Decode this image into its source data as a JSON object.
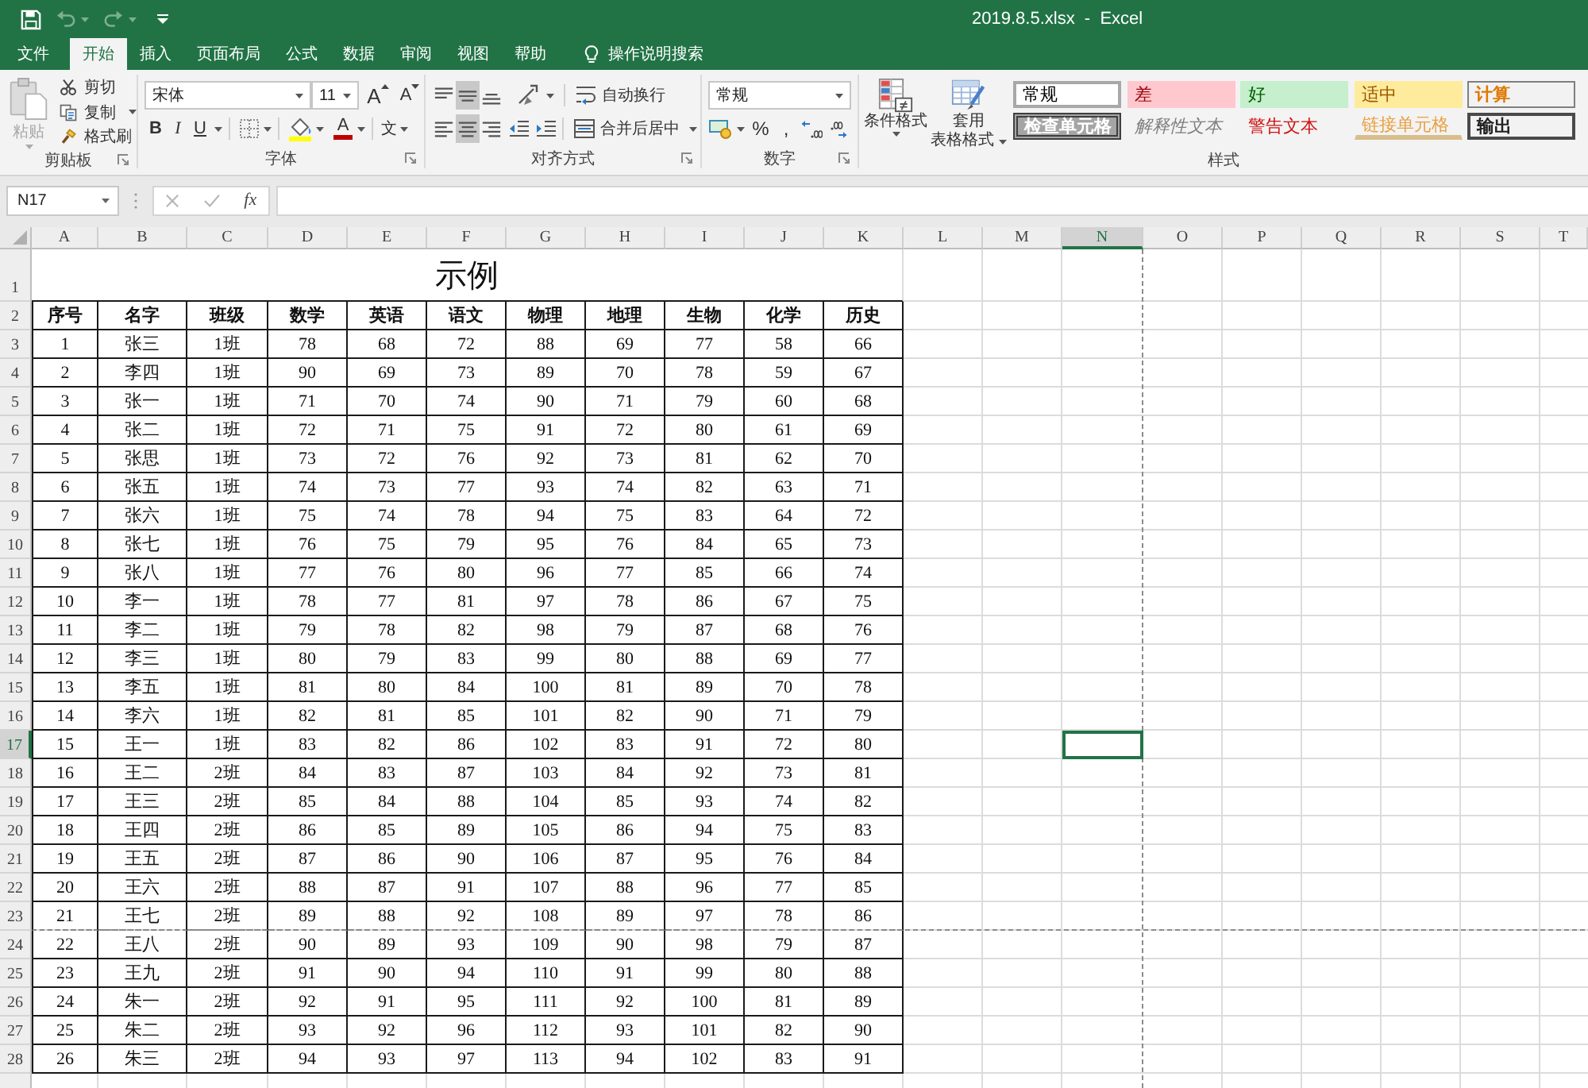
{
  "window": {
    "title": "2019.8.5.xlsx  -  Excel"
  },
  "quick_access": [
    {
      "kind": "save",
      "disabled": false
    },
    {
      "kind": "undo",
      "disabled": true
    },
    {
      "kind": "redo",
      "disabled": true
    },
    {
      "kind": "customize",
      "disabled": false
    }
  ],
  "tabs": [
    {
      "label": "文件",
      "selected": false
    },
    {
      "label": "开始",
      "selected": true
    },
    {
      "label": "插入",
      "selected": false
    },
    {
      "label": "页面布局",
      "selected": false
    },
    {
      "label": "公式",
      "selected": false
    },
    {
      "label": "数据",
      "selected": false
    },
    {
      "label": "审阅",
      "selected": false
    },
    {
      "label": "视图",
      "selected": false
    },
    {
      "label": "帮助",
      "selected": false
    }
  ],
  "tell_me": {
    "label": "操作说明搜索"
  },
  "ribbon": {
    "clipboard": {
      "label": "剪贴板",
      "paste": {
        "label": "粘贴",
        "disabled": true
      },
      "buttons": [
        {
          "kind": "cut",
          "label": "剪切"
        },
        {
          "kind": "copy",
          "label": "复制"
        },
        {
          "kind": "format_painter",
          "label": "格式刷"
        }
      ]
    },
    "font": {
      "label": "字体",
      "font_name": "宋体",
      "font_size": "11",
      "grow": "A",
      "shrink": "A",
      "styles": [
        {
          "kind": "bold",
          "label": "B"
        },
        {
          "kind": "italic",
          "label": "I"
        },
        {
          "kind": "underline",
          "label": "U"
        }
      ],
      "font_color": "A",
      "phonetic": "文"
    },
    "alignment": {
      "label": "对齐方式",
      "vertical": [
        {
          "kind": "top",
          "selected": false
        },
        {
          "kind": "middle",
          "selected": true
        },
        {
          "kind": "bottom",
          "selected": false
        }
      ],
      "horizontal": [
        {
          "kind": "left",
          "selected": false
        },
        {
          "kind": "center",
          "selected": true
        },
        {
          "kind": "right",
          "selected": false
        }
      ],
      "wrap_text": "自动换行",
      "merge_center": "合并后居中"
    },
    "number": {
      "label": "数字",
      "format": "常规",
      "percent": "%",
      "comma": ","
    },
    "styles": {
      "label": "样式",
      "conditional_format": "条件格式",
      "format_table": [
        "套用",
        "表格格式"
      ],
      "cell_styles": [
        {
          "kind": "normal",
          "label": "常规"
        },
        {
          "kind": "bad",
          "label": "差"
        },
        {
          "kind": "good",
          "label": "好"
        },
        {
          "kind": "neutral",
          "label": "适中"
        },
        {
          "kind": "calculation",
          "label": "计算"
        },
        {
          "kind": "check",
          "label": "检查单元格"
        },
        {
          "kind": "explanatory",
          "label": "解释性文本"
        },
        {
          "kind": "warning",
          "label": "警告文本"
        },
        {
          "kind": "linked",
          "label": "链接单元格"
        },
        {
          "kind": "output",
          "label": "输出"
        }
      ]
    }
  },
  "formula_bar": {
    "name_box": "N17",
    "function_label": "fx"
  },
  "sheet": {
    "columns": [
      {
        "label": "A",
        "selected": false
      },
      {
        "label": "B",
        "selected": false
      },
      {
        "label": "C",
        "selected": false
      },
      {
        "label": "D",
        "selected": false
      },
      {
        "label": "E",
        "selected": false
      },
      {
        "label": "F",
        "selected": false
      },
      {
        "label": "G",
        "selected": false
      },
      {
        "label": "H",
        "selected": false
      },
      {
        "label": "I",
        "selected": false
      },
      {
        "label": "J",
        "selected": false
      },
      {
        "label": "K",
        "selected": false
      },
      {
        "label": "L",
        "selected": false
      },
      {
        "label": "M",
        "selected": false
      },
      {
        "label": "N",
        "selected": true
      },
      {
        "label": "O",
        "selected": false
      },
      {
        "label": "P",
        "selected": false
      },
      {
        "label": "Q",
        "selected": false
      },
      {
        "label": "R",
        "selected": false
      },
      {
        "label": "S",
        "selected": false
      },
      {
        "label": "T",
        "selected": false
      }
    ],
    "rows": [
      {
        "label": "1",
        "selected": false
      },
      {
        "label": "2",
        "selected": false
      },
      {
        "label": "3",
        "selected": false
      },
      {
        "label": "4",
        "selected": false
      },
      {
        "label": "5",
        "selected": false
      },
      {
        "label": "6",
        "selected": false
      },
      {
        "label": "7",
        "selected": false
      },
      {
        "label": "8",
        "selected": false
      },
      {
        "label": "9",
        "selected": false
      },
      {
        "label": "10",
        "selected": false
      },
      {
        "label": "11",
        "selected": false
      },
      {
        "label": "12",
        "selected": false
      },
      {
        "label": "13",
        "selected": false
      },
      {
        "label": "14",
        "selected": false
      },
      {
        "label": "15",
        "selected": false
      },
      {
        "label": "16",
        "selected": false
      },
      {
        "label": "17",
        "selected": true
      },
      {
        "label": "18",
        "selected": false
      },
      {
        "label": "19",
        "selected": false
      },
      {
        "label": "20",
        "selected": false
      },
      {
        "label": "21",
        "selected": false
      },
      {
        "label": "22",
        "selected": false
      },
      {
        "label": "23",
        "selected": false
      },
      {
        "label": "24",
        "selected": false
      },
      {
        "label": "25",
        "selected": false
      },
      {
        "label": "26",
        "selected": false
      },
      {
        "label": "27",
        "selected": false
      },
      {
        "label": "28",
        "selected": false
      }
    ],
    "title": "示例",
    "table": {
      "header": [
        "序号",
        "名字",
        "班级",
        "数学",
        "英语",
        "语文",
        "物理",
        "地理",
        "生物",
        "化学",
        "历史"
      ],
      "rows": [
        [
          "1",
          "张三",
          "1班",
          "78",
          "68",
          "72",
          "88",
          "69",
          "77",
          "58",
          "66"
        ],
        [
          "2",
          "李四",
          "1班",
          "90",
          "69",
          "73",
          "89",
          "70",
          "78",
          "59",
          "67"
        ],
        [
          "3",
          "张一",
          "1班",
          "71",
          "70",
          "74",
          "90",
          "71",
          "79",
          "60",
          "68"
        ],
        [
          "4",
          "张二",
          "1班",
          "72",
          "71",
          "75",
          "91",
          "72",
          "80",
          "61",
          "69"
        ],
        [
          "5",
          "张思",
          "1班",
          "73",
          "72",
          "76",
          "92",
          "73",
          "81",
          "62",
          "70"
        ],
        [
          "6",
          "张五",
          "1班",
          "74",
          "73",
          "77",
          "93",
          "74",
          "82",
          "63",
          "71"
        ],
        [
          "7",
          "张六",
          "1班",
          "75",
          "74",
          "78",
          "94",
          "75",
          "83",
          "64",
          "72"
        ],
        [
          "8",
          "张七",
          "1班",
          "76",
          "75",
          "79",
          "95",
          "76",
          "84",
          "65",
          "73"
        ],
        [
          "9",
          "张八",
          "1班",
          "77",
          "76",
          "80",
          "96",
          "77",
          "85",
          "66",
          "74"
        ],
        [
          "10",
          "李一",
          "1班",
          "78",
          "77",
          "81",
          "97",
          "78",
          "86",
          "67",
          "75"
        ],
        [
          "11",
          "李二",
          "1班",
          "79",
          "78",
          "82",
          "98",
          "79",
          "87",
          "68",
          "76"
        ],
        [
          "12",
          "李三",
          "1班",
          "80",
          "79",
          "83",
          "99",
          "80",
          "88",
          "69",
          "77"
        ],
        [
          "13",
          "李五",
          "1班",
          "81",
          "80",
          "84",
          "100",
          "81",
          "89",
          "70",
          "78"
        ],
        [
          "14",
          "李六",
          "1班",
          "82",
          "81",
          "85",
          "101",
          "82",
          "90",
          "71",
          "79"
        ],
        [
          "15",
          "王一",
          "1班",
          "83",
          "82",
          "86",
          "102",
          "83",
          "91",
          "72",
          "80"
        ],
        [
          "16",
          "王二",
          "2班",
          "84",
          "83",
          "87",
          "103",
          "84",
          "92",
          "73",
          "81"
        ],
        [
          "17",
          "王三",
          "2班",
          "85",
          "84",
          "88",
          "104",
          "85",
          "93",
          "74",
          "82"
        ],
        [
          "18",
          "王四",
          "2班",
          "86",
          "85",
          "89",
          "105",
          "86",
          "94",
          "75",
          "83"
        ],
        [
          "19",
          "王五",
          "2班",
          "87",
          "86",
          "90",
          "106",
          "87",
          "95",
          "76",
          "84"
        ],
        [
          "20",
          "王六",
          "2班",
          "88",
          "87",
          "91",
          "107",
          "88",
          "96",
          "77",
          "85"
        ],
        [
          "21",
          "王七",
          "2班",
          "89",
          "88",
          "92",
          "108",
          "89",
          "97",
          "78",
          "86"
        ],
        [
          "22",
          "王八",
          "2班",
          "90",
          "89",
          "93",
          "109",
          "90",
          "98",
          "79",
          "87"
        ],
        [
          "23",
          "王九",
          "2班",
          "91",
          "90",
          "94",
          "110",
          "91",
          "99",
          "80",
          "88"
        ],
        [
          "24",
          "朱一",
          "2班",
          "92",
          "91",
          "95",
          "111",
          "92",
          "100",
          "81",
          "89"
        ],
        [
          "25",
          "朱二",
          "2班",
          "93",
          "92",
          "96",
          "112",
          "93",
          "101",
          "82",
          "90"
        ],
        [
          "26",
          "朱三",
          "2班",
          "94",
          "93",
          "97",
          "113",
          "94",
          "102",
          "83",
          "91"
        ]
      ]
    }
  }
}
